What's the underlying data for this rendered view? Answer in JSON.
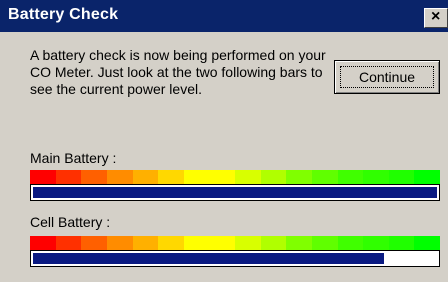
{
  "window": {
    "title": "Battery Check",
    "close_glyph": "×"
  },
  "message": "A battery check is now being performed on your CO Meter. Just look at the two following bars to see the current power level.",
  "continue_label": "Continue",
  "batteries": [
    {
      "label": "Main Battery :",
      "level": 1.0
    },
    {
      "label": "Cell Battery :",
      "level": 0.87
    }
  ],
  "colors": {
    "title_bar": "#0a246a",
    "bar_fill": "#0a1a82",
    "scale": [
      "#ff0000",
      "#ff3000",
      "#ff6000",
      "#ff8c00",
      "#ffb000",
      "#ffd800",
      "#ffff00",
      "#ffff00",
      "#d8ff00",
      "#b0ff00",
      "#80ff00",
      "#60ff00",
      "#40ff00",
      "#30ff00",
      "#20ff00",
      "#00ff00"
    ]
  }
}
